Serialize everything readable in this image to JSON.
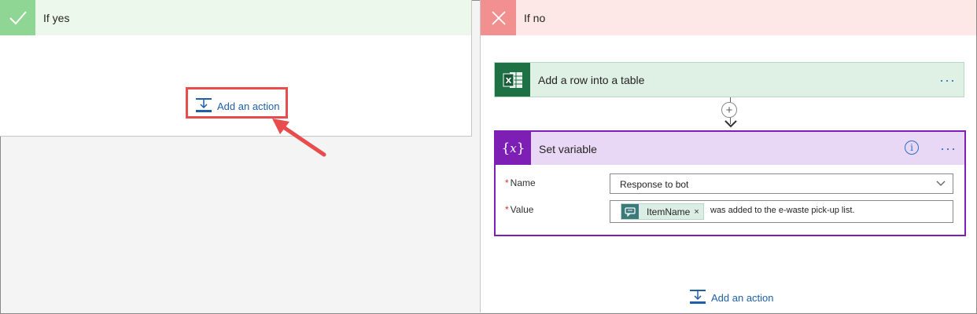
{
  "branches": {
    "yes": {
      "title": "If yes",
      "add_action_label": "Add an action"
    },
    "no": {
      "title": "If no",
      "add_action_label": "Add an action"
    }
  },
  "excel_card": {
    "title": "Add a row into a table",
    "more": "···"
  },
  "set_variable": {
    "title": "Set variable",
    "more": "···",
    "info": "i",
    "name_label": "Name",
    "name_value": "Response to bot",
    "value_label": "Value",
    "token_label": "ItemName",
    "token_remove": "×",
    "value_text": "was added to the e-waste pick-up list.",
    "required_marker": "*"
  },
  "icons": {
    "yes": "checkmark-icon",
    "no": "close-icon",
    "excel": "excel-icon",
    "variable": "variable-icon",
    "add": "add-action-icon"
  },
  "colors": {
    "yes_accent": "#8fd694",
    "no_accent": "#f1908f",
    "excel": "#1e7145",
    "variable": "#7d1fb4",
    "link": "#1f5fa8",
    "callout": "#e84c4c"
  }
}
